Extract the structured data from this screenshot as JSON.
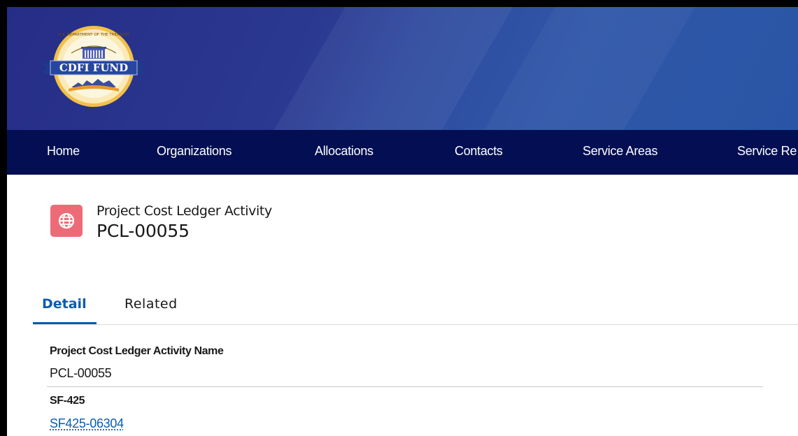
{
  "header": {
    "logo": {
      "icon": "cdfi-fund-seal",
      "banner_text": "CDFI FUND",
      "ring_text": "U.S. DEPARTMENT OF THE TREASURY"
    },
    "colors": {
      "banner": "#2b3991",
      "nav": "#030f52"
    }
  },
  "nav": {
    "items": [
      {
        "label": "Home"
      },
      {
        "label": "Organizations"
      },
      {
        "label": "Allocations"
      },
      {
        "label": "Contacts"
      },
      {
        "label": "Service Areas"
      },
      {
        "label": "Service Re"
      }
    ]
  },
  "record": {
    "icon": "globe-icon",
    "icon_color": "#ed6b77",
    "type_label": "Project Cost Ledger Activity",
    "name": "PCL-00055"
  },
  "tabs": [
    {
      "label": "Detail",
      "active": true
    },
    {
      "label": "Related",
      "active": false
    }
  ],
  "fields": [
    {
      "label": "Project Cost Ledger Activity Name",
      "value": "PCL-00055"
    },
    {
      "label": "SF-425",
      "value": "SF425-06304"
    }
  ]
}
